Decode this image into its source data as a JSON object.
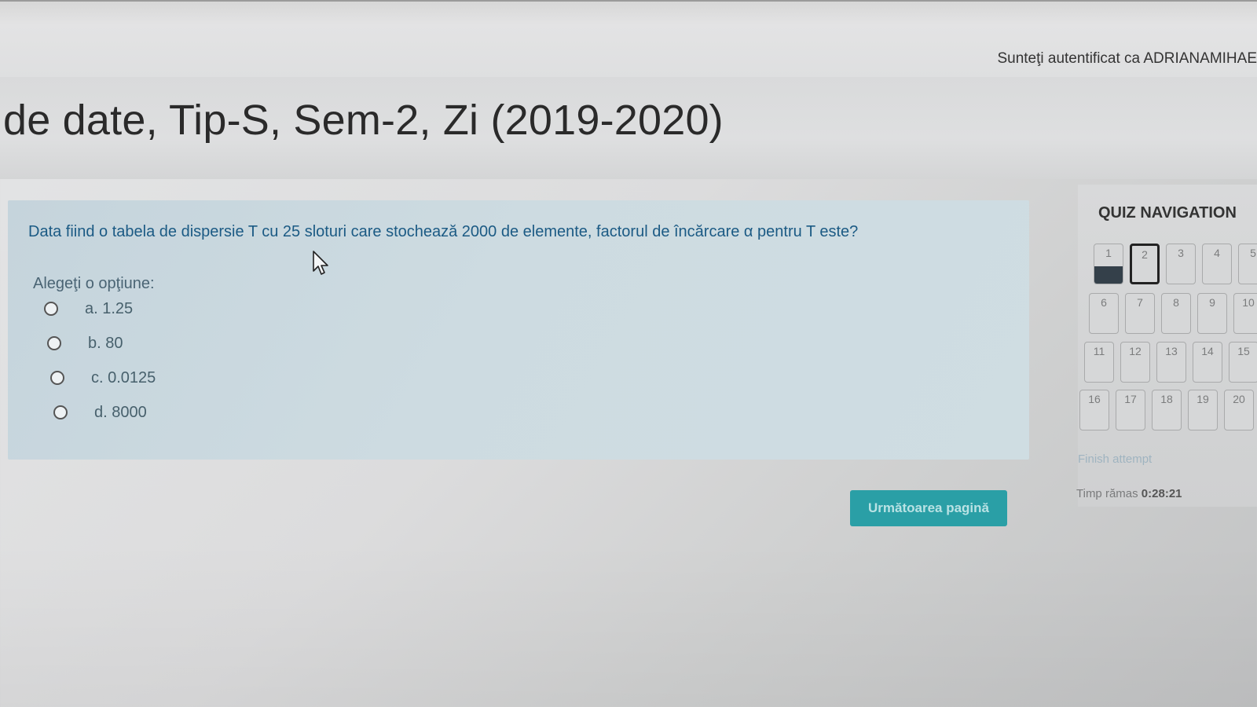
{
  "header": {
    "auth_text": "Sunteţi autentificat ca ADRIANAMIHAE"
  },
  "page": {
    "title": "de date, Tip-S, Sem-2, Zi (2019-2020)"
  },
  "question": {
    "text": "Data fiind o tabela de dispersie T cu 25 sloturi care stochează 2000 de elemente, factorul de încărcare α pentru T este?",
    "prompt": "Alegeţi o opţiune:",
    "options": [
      {
        "label": "a. 1.25"
      },
      {
        "label": "b. 80"
      },
      {
        "label": "c. 0.0125"
      },
      {
        "label": "d. 8000"
      }
    ],
    "next_button": "Următoarea pagină"
  },
  "quiz_navigation": {
    "title": "QUIZ NAVIGATION",
    "buttons": [
      "1",
      "2",
      "3",
      "4",
      "5",
      "6",
      "7",
      "8",
      "9",
      "10",
      "11",
      "12",
      "13",
      "14",
      "15",
      "16",
      "17",
      "18",
      "19",
      "20"
    ],
    "answered": [
      "1"
    ],
    "current": "2",
    "finish_link": "Finish attempt",
    "timer_label": "Timp rămas",
    "timer_value": "0:28:21"
  },
  "colors": {
    "question_text": "#1b5a84",
    "button_bg": "#2a9fa6",
    "answered_fill": "#34404a"
  },
  "icons": {
    "mouse_pointer": "mouse-cursor-icon"
  }
}
